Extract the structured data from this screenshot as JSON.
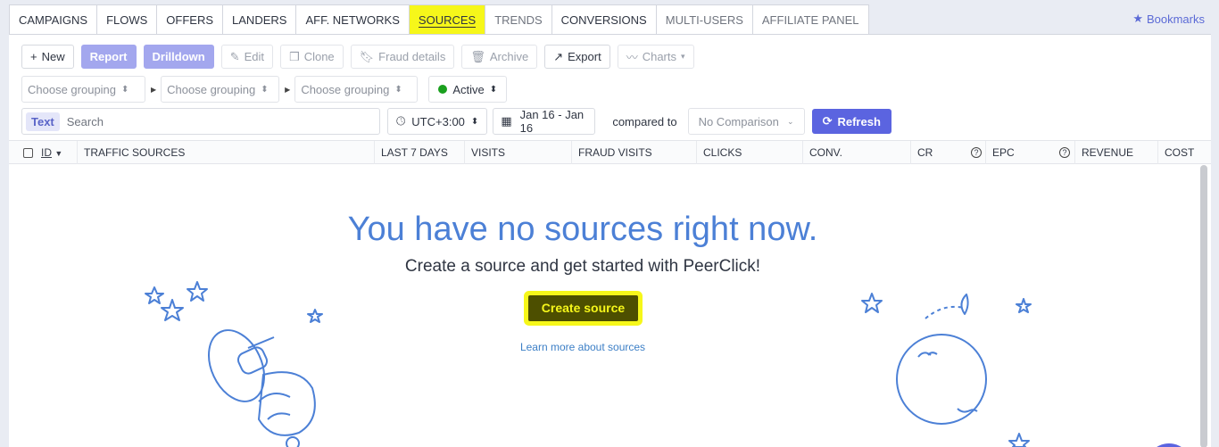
{
  "tabs": [
    {
      "label": "CAMPAIGNS"
    },
    {
      "label": "FLOWS"
    },
    {
      "label": "OFFERS"
    },
    {
      "label": "LANDERS"
    },
    {
      "label": "AFF. NETWORKS"
    },
    {
      "label": "SOURCES"
    },
    {
      "label": "TRENDS"
    },
    {
      "label": "CONVERSIONS"
    },
    {
      "label": "MULTI-USERS"
    },
    {
      "label": "AFFILIATE PANEL"
    }
  ],
  "bookmarks": "Bookmarks",
  "toolbar": {
    "new": "New",
    "report": "Report",
    "drilldown": "Drilldown",
    "edit": "Edit",
    "clone": "Clone",
    "fraud": "Fraud details",
    "archive": "Archive",
    "export": "Export",
    "charts": "Charts"
  },
  "grouping": {
    "placeholder1": "Choose grouping",
    "placeholder2": "Choose grouping",
    "placeholder3": "Choose grouping",
    "status": "Active"
  },
  "search": {
    "tag": "Text",
    "placeholder": "Search",
    "timezone": "UTC+3:00",
    "date_range": "Jan 16 - Jan 16",
    "compared_to": "compared to",
    "comparison": "No Comparison",
    "refresh": "Refresh"
  },
  "columns": {
    "id": "ID",
    "source": "TRAFFIC SOURCES",
    "last7": "LAST 7 DAYS",
    "visits": "VISITS",
    "fraud": "FRAUD VISITS",
    "clicks": "CLICKS",
    "conv": "CONV.",
    "cr": "CR",
    "epc": "EPC",
    "revenue": "REVENUE",
    "cost": "COST"
  },
  "empty": {
    "title": "You have no sources right now.",
    "subtitle": "Create a source and get started with PeerClick!",
    "cta": "Create source",
    "learn": "Learn more about sources"
  },
  "colors": {
    "accent": "#5b64e0",
    "highlight": "#f6f71a",
    "illustration": "#4c80d6"
  }
}
